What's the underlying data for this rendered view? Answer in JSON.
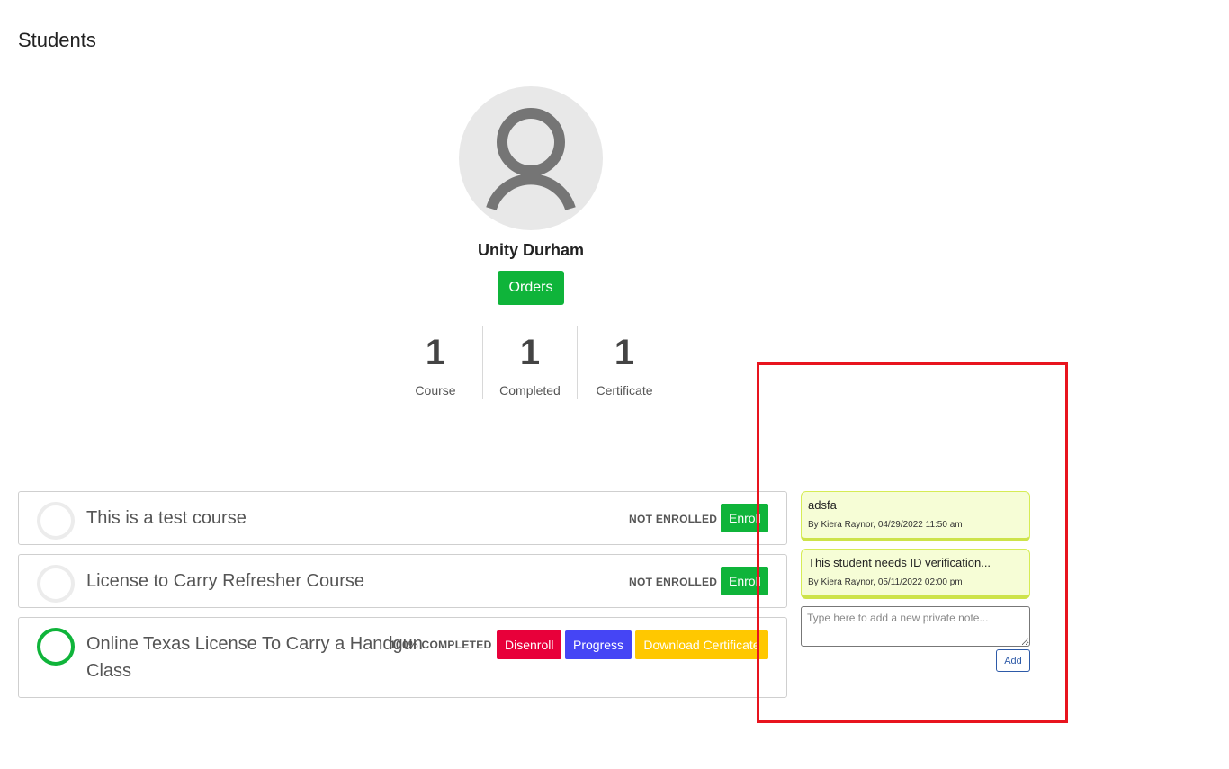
{
  "page": {
    "title": "Students"
  },
  "student": {
    "name": "Unity Durham",
    "orders_label": "Orders"
  },
  "stats": [
    {
      "value": "1",
      "label": "Course"
    },
    {
      "value": "1",
      "label": "Completed"
    },
    {
      "value": "1",
      "label": "Certificate"
    }
  ],
  "courses": [
    {
      "title": "This is a test course",
      "status": "NOT ENROLLED",
      "enroll_label": "Enroll"
    },
    {
      "title": "License to Carry Refresher Course",
      "status": "NOT ENROLLED",
      "enroll_label": "Enroll"
    },
    {
      "title": "Online Texas License To Carry a Handgun Class",
      "status": "100% COMPLETED",
      "disenroll_label": "Disenroll",
      "progress_label": "Progress",
      "certificate_label": "Download Certificate"
    }
  ],
  "notes": {
    "items": [
      {
        "text": "adsfa",
        "meta": "By Kiera Raynor, 04/29/2022 11:50 am"
      },
      {
        "text": "This student needs ID verification...",
        "meta": "By Kiera Raynor, 05/11/2022 02:00 pm"
      }
    ],
    "placeholder": "Type here to add a new private note...",
    "add_label": "Add"
  },
  "colors": {
    "green": "#0fb43a",
    "red": "#e8003a",
    "blue": "#4545f5",
    "yellow": "#ffc800",
    "note_bg": "#f6fdd6",
    "highlight": "#e8141e"
  },
  "icons": {
    "avatar": "user-icon"
  }
}
